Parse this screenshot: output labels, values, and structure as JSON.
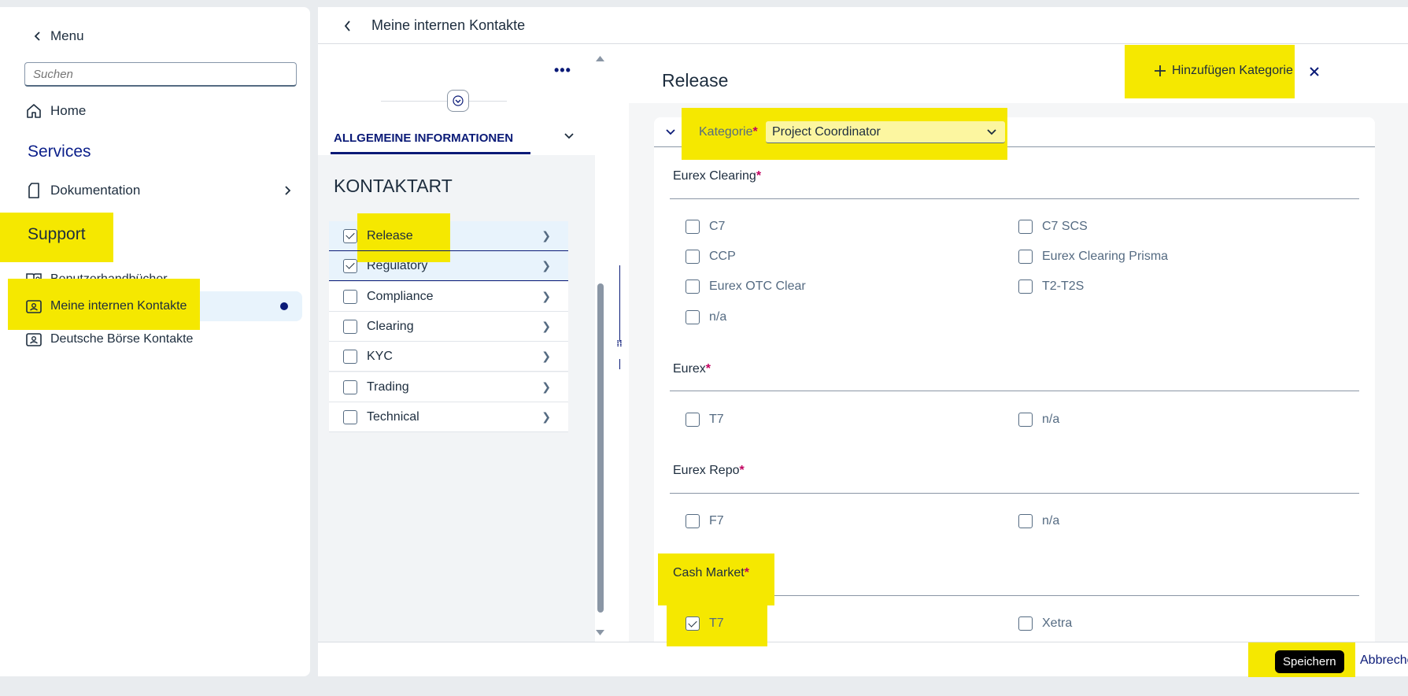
{
  "sidebar": {
    "menu_label": "Menu",
    "search_placeholder": "Suchen",
    "home_label": "Home",
    "services_title": "Services",
    "documentation_label": "Dokumentation",
    "support_title": "Support",
    "items": [
      {
        "label": "Benutzerhandbücher"
      },
      {
        "label": "Meine internen Kontakte"
      },
      {
        "label": "Deutsche Börse Kontakte"
      }
    ]
  },
  "header": {
    "title": "Meine internen Kontakte"
  },
  "left_pane": {
    "tab_label": "ALLGEMEINE INFORMATIONEN",
    "section_title": "KONTAKTART",
    "categories": [
      {
        "label": "Release",
        "checked": true
      },
      {
        "label": "Regulatory",
        "checked": true
      },
      {
        "label": "Compliance",
        "checked": false
      },
      {
        "label": "Clearing",
        "checked": false
      },
      {
        "label": "KYC",
        "checked": false
      },
      {
        "label": "Trading",
        "checked": false
      },
      {
        "label": "Technical",
        "checked": false
      }
    ]
  },
  "right_pane": {
    "title": "Release",
    "add_category_label": "Hinzufügen Kategorie",
    "category_label": "Kategorie",
    "required_mark": "*",
    "category_value": "Project Coordinator",
    "sections": [
      {
        "title": "Eurex Clearing",
        "options": [
          {
            "label": "C7",
            "checked": false
          },
          {
            "label": "C7 SCS",
            "checked": false
          },
          {
            "label": "CCP",
            "checked": false
          },
          {
            "label": "Eurex Clearing Prisma",
            "checked": false
          },
          {
            "label": "Eurex OTC Clear",
            "checked": false
          },
          {
            "label": "T2-T2S",
            "checked": false
          },
          {
            "label": "n/a",
            "checked": false
          }
        ]
      },
      {
        "title": "Eurex",
        "options": [
          {
            "label": "T7",
            "checked": false
          },
          {
            "label": "n/a",
            "checked": false
          }
        ]
      },
      {
        "title": "Eurex Repo",
        "options": [
          {
            "label": "F7",
            "checked": false
          },
          {
            "label": "n/a",
            "checked": false
          }
        ]
      },
      {
        "title": "Cash Market",
        "options": [
          {
            "label": "T7",
            "checked": true
          },
          {
            "label": "Xetra",
            "checked": false
          }
        ]
      }
    ]
  },
  "footer": {
    "save_label": "Speichern",
    "cancel_label": "Abbreche"
  },
  "colors": {
    "highlight": "#f5e800",
    "accent": "#0a1a77",
    "required": "#c1005f"
  }
}
